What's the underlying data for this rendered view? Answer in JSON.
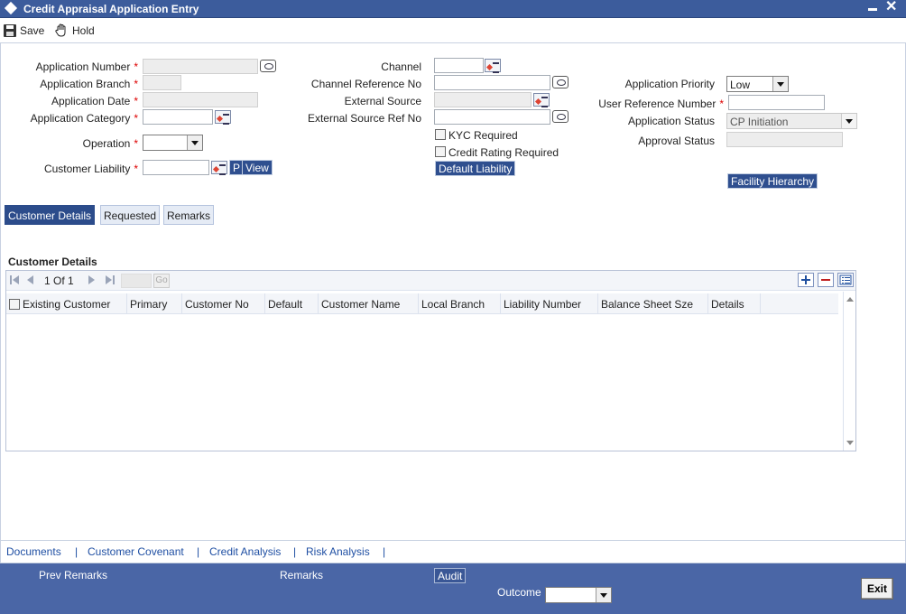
{
  "window": {
    "title": "Credit Appraisal Application Entry"
  },
  "toolbar": {
    "save_label": "Save",
    "hold_label": "Hold"
  },
  "form": {
    "application_number_label": "Application Number",
    "application_branch_label": "Application Branch",
    "application_date_label": "Application Date",
    "application_category_label": "Application Category",
    "operation_label": "Operation",
    "customer_liability_label": "Customer Liability",
    "p_button": "P",
    "view_button": "View",
    "channel_label": "Channel",
    "channel_ref_label": "Channel Reference No",
    "external_source_label": "External Source",
    "external_source_ref_label": "External Source Ref No",
    "kyc_label": "KYC Required",
    "credit_rating_label": "Credit Rating Required",
    "default_liability_button": "Default Liability",
    "application_priority_label": "Application Priority",
    "application_priority_value": "Low",
    "user_reference_label": "User Reference Number",
    "application_status_label": "Application Status",
    "application_status_value": "CP Initiation",
    "approval_status_label": "Approval Status",
    "facility_hierarchy_button": "Facility Hierarchy",
    "required_marker": "*"
  },
  "tabs": [
    {
      "label": "Customer Details",
      "active": true
    },
    {
      "label": "Requested",
      "active": false
    },
    {
      "label": "Remarks",
      "active": false
    }
  ],
  "customer_details": {
    "section_title": "Customer Details",
    "pager": {
      "page_text": "1 Of 1",
      "go_label": "Go"
    },
    "columns": [
      "Existing Customer",
      "Primary",
      "Customer No",
      "Default",
      "Customer Name",
      "Local Branch",
      "Liability Number",
      "Balance Sheet Sze",
      "Details"
    ]
  },
  "bottom_links": [
    "Documents",
    "Customer Covenant",
    "Credit Analysis",
    "Risk Analysis"
  ],
  "link_separator": "|",
  "footer": {
    "prev_remarks_label": "Prev Remarks",
    "remarks_label": "Remarks",
    "audit_button": "Audit",
    "outcome_label": "Outcome",
    "exit_button": "Exit"
  },
  "colors": {
    "title_bar": "#3c5c9c",
    "active_tab": "#2c4c8b",
    "footer": "#4a66a6",
    "link": "#1f4fa3",
    "required": "#dd0000"
  },
  "icons": [
    "window-diamond-icon",
    "minimize-icon",
    "close-icon",
    "save-icon",
    "hold-hand-icon",
    "lov-icon",
    "comment-bubble-icon",
    "first-page-icon",
    "prev-page-icon",
    "next-page-icon",
    "last-page-icon",
    "add-row-icon",
    "delete-row-icon",
    "single-view-icon"
  ]
}
